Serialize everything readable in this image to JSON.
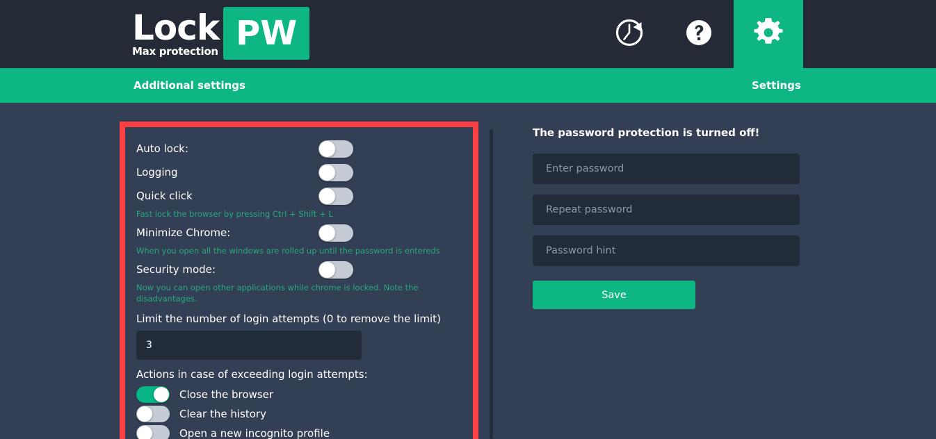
{
  "header": {
    "brand_name": "Lock",
    "brand_tagline": "Max protection",
    "brand_badge": "PW",
    "icons": [
      {
        "name": "history-icon",
        "label": "History"
      },
      {
        "name": "help-icon",
        "label": "Help"
      },
      {
        "name": "gear-icon",
        "label": "Settings"
      }
    ]
  },
  "subbar": {
    "title": "Additional settings",
    "right_label": "Settings"
  },
  "settings": {
    "rows": [
      {
        "label": "Auto lock:",
        "state": "off",
        "helper": ""
      },
      {
        "label": "Logging",
        "state": "off",
        "helper": ""
      },
      {
        "label": "Quick click",
        "state": "off",
        "helper": "Fast lock the browser by pressing Ctrl + Shift + L"
      },
      {
        "label": "Minimize Chrome:",
        "state": "off",
        "helper": "When you open all the windows are rolled up until the password is entereds"
      },
      {
        "label": "Security mode:",
        "state": "off",
        "helper": "Now you can open other applications while chrome is locked. Note the disadvantages."
      }
    ],
    "limit_title": "Limit the number of login attempts (0 to remove the limit)",
    "limit_value": "3",
    "actions_title": "Actions in case of exceeding login attempts:",
    "actions": [
      {
        "label": "Close the browser",
        "state": "on"
      },
      {
        "label": "Clear the history",
        "state": "off"
      },
      {
        "label": "Open a new incognito profile",
        "state": "off"
      }
    ]
  },
  "password_panel": {
    "status": "The password protection is turned off!",
    "enter_password_placeholder": "Enter password",
    "enter_password_value": "",
    "repeat_password_placeholder": "Repeat password",
    "repeat_password_value": "",
    "password_hint_placeholder": "Password hint",
    "password_hint_value": "",
    "save_label": "Save"
  },
  "colors": {
    "accent_green": "#0eb683",
    "header_dark": "#242a36",
    "page_bg": "#333f54",
    "input_bg": "#222b38",
    "highlight_red": "#fc4043",
    "helper_green": "#27a880"
  }
}
